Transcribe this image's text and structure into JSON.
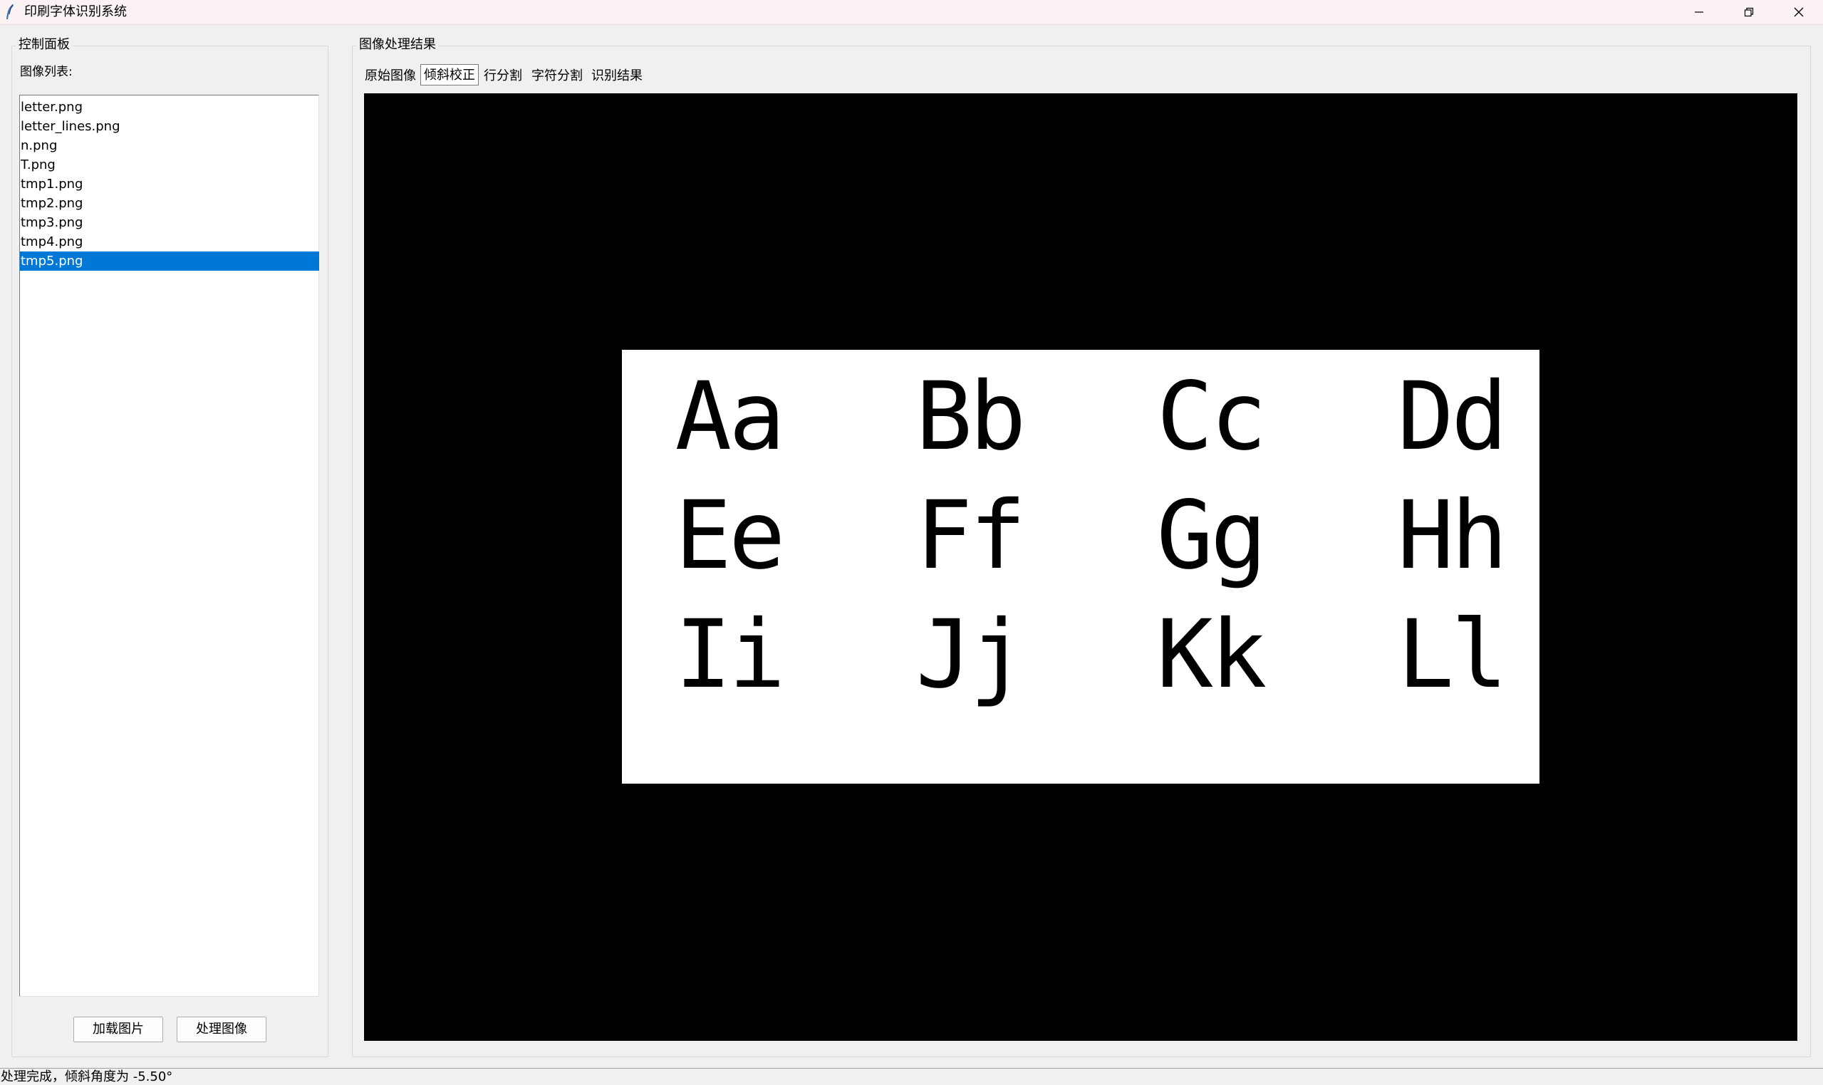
{
  "window": {
    "title": "印刷字体识别系统"
  },
  "control_panel": {
    "title": "控制面板",
    "list_label": "图像列表:",
    "files": [
      "letter.png",
      "letter_lines.png",
      "n.png",
      "T.png",
      "tmp1.png",
      "tmp2.png",
      "tmp3.png",
      "tmp4.png",
      "tmp5.png"
    ],
    "selected_file": "tmp5.png",
    "load_button": "加载图片",
    "process_button": "处理图像"
  },
  "result_panel": {
    "title": "图像处理结果",
    "tabs": [
      "原始图像",
      "倾斜校正",
      "行分割",
      "字符分割",
      "识别结果"
    ],
    "active_tab": "倾斜校正",
    "image_glyphs": [
      [
        "Aa",
        "Bb",
        "Cc",
        "Dd"
      ],
      [
        "Ee",
        "Ff",
        "Gg",
        "Hh"
      ],
      [
        "Ii",
        "Jj",
        "Kk",
        "Ll"
      ]
    ]
  },
  "status": {
    "text": "处理完成，倾斜角度为 -5.50°"
  },
  "colors": {
    "selection": "#0078d7",
    "canvas_bg": "#000000",
    "titlebar_bg": "#fbf3f3"
  }
}
